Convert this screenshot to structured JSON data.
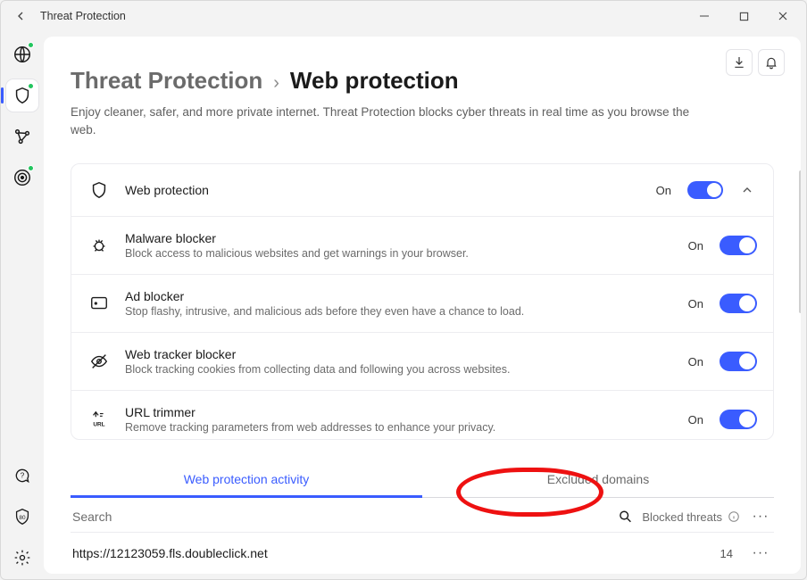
{
  "window": {
    "title": "Threat Protection"
  },
  "top_actions": {
    "download_name": "download-icon",
    "bell_name": "bell-icon"
  },
  "header": {
    "parent": "Threat Protection",
    "current": "Web protection",
    "subhead": "Enjoy cleaner, safer, and more private internet. Threat Protection blocks cyber threats in real time as you browse the web."
  },
  "rail": [
    "globe-icon",
    "shield-icon",
    "mesh-icon",
    "target-icon",
    "chat-icon",
    "shield80-icon",
    "settings-icon"
  ],
  "main_row": {
    "title": "Web protection",
    "state": "On"
  },
  "features": [
    {
      "icon": "bug-icon",
      "title": "Malware blocker",
      "desc": "Block access to malicious websites and get warnings in your browser.",
      "state": "On"
    },
    {
      "icon": "ad-icon",
      "title": "Ad blocker",
      "desc": "Stop flashy, intrusive, and malicious ads before they even have a chance to load.",
      "state": "On"
    },
    {
      "icon": "eye-off-icon",
      "title": "Web tracker blocker",
      "desc": "Block tracking cookies from collecting data and following you across websites.",
      "state": "On"
    },
    {
      "icon": "url-icon",
      "title": "URL trimmer",
      "desc": "Remove tracking parameters from web addresses to enhance your privacy.",
      "state": "On"
    }
  ],
  "tabs": {
    "active": "Web protection activity",
    "inactive": "Excluded domains"
  },
  "activity": {
    "search_placeholder": "Search",
    "header_label": "Blocked threats",
    "rows": [
      {
        "url": "https://12123059.fls.doubleclick.net",
        "count": "14"
      }
    ]
  }
}
